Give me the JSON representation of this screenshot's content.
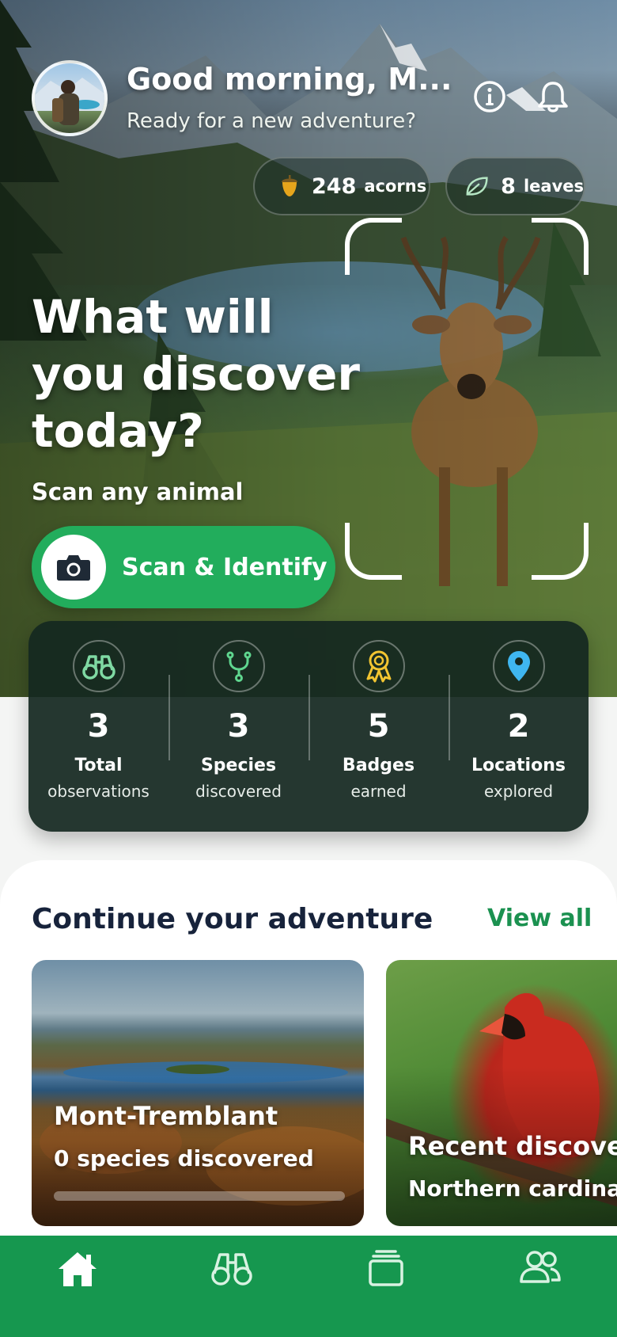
{
  "header": {
    "greeting": "Good morning, M...",
    "subtitle": "Ready for a new adventure?",
    "info_icon": "info-icon",
    "bell_icon": "bell-icon"
  },
  "currency": [
    {
      "icon": "acorn-icon",
      "value": "248",
      "unit": "acorns"
    },
    {
      "icon": "leaf-icon",
      "value": "8",
      "unit": "leaves"
    }
  ],
  "hero": {
    "headline": "What will you discover today?",
    "subline": "Scan any animal",
    "scan_button": "Scan & Identify"
  },
  "stats": [
    {
      "icon": "binoculars-icon",
      "value": "3",
      "label1": "Total",
      "label2": "observations",
      "color": "#7fd9a3"
    },
    {
      "icon": "stethoscope-icon",
      "value": "3",
      "label1": "Species",
      "label2": "discovered",
      "color": "#5fd68f"
    },
    {
      "icon": "badge-icon",
      "value": "5",
      "label1": "Badges",
      "label2": "earned",
      "color": "#f2c531"
    },
    {
      "icon": "location-pin-icon",
      "value": "2",
      "label1": "Locations",
      "label2": "explored",
      "color": "#3fb6f0"
    }
  ],
  "adventure": {
    "title": "Continue your adventure",
    "view_all": "View all",
    "cards": [
      {
        "title": "Mont-Tremblant",
        "subtitle": "0 species discovered",
        "progress": 0
      },
      {
        "title": "Recent discover",
        "subtitle": "Northern cardinal"
      }
    ]
  },
  "nav": [
    {
      "icon": "home-icon",
      "active": true
    },
    {
      "icon": "binoculars-icon"
    },
    {
      "icon": "collection-icon"
    },
    {
      "icon": "community-icon"
    }
  ],
  "colors": {
    "accent": "#22ad5c",
    "nav_bg": "#16974f",
    "stats_bg": "#142820",
    "title_text": "#17233b",
    "link_text": "#1b9150"
  }
}
